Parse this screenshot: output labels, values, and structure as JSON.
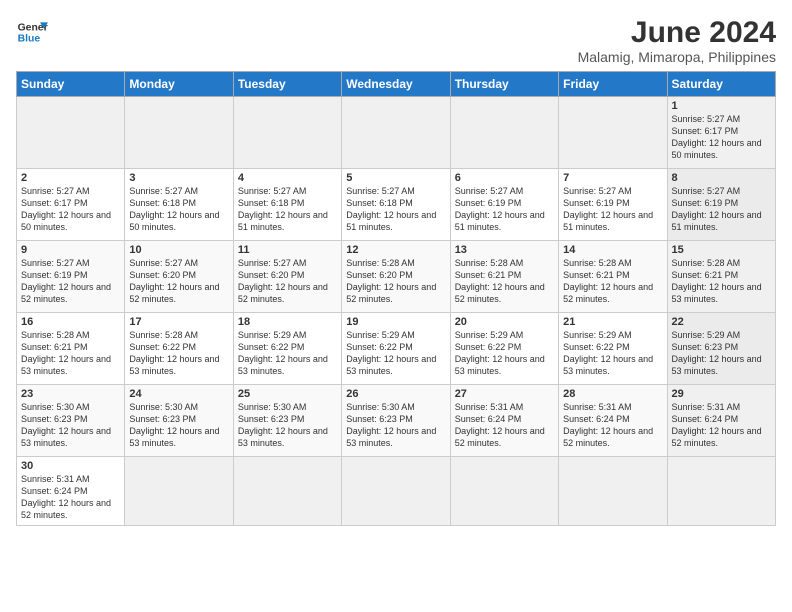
{
  "logo": {
    "line1": "General",
    "line2": "Blue"
  },
  "title": "June 2024",
  "subtitle": "Malamig, Mimaropa, Philippines",
  "days_of_week": [
    "Sunday",
    "Monday",
    "Tuesday",
    "Wednesday",
    "Thursday",
    "Friday",
    "Saturday"
  ],
  "weeks": [
    [
      {
        "day": "",
        "info": ""
      },
      {
        "day": "",
        "info": ""
      },
      {
        "day": "",
        "info": ""
      },
      {
        "day": "",
        "info": ""
      },
      {
        "day": "",
        "info": ""
      },
      {
        "day": "",
        "info": ""
      },
      {
        "day": "1",
        "info": "Sunrise: 5:27 AM\nSunset: 6:17 PM\nDaylight: 12 hours\nand 50 minutes."
      }
    ],
    [
      {
        "day": "2",
        "info": "Sunrise: 5:27 AM\nSunset: 6:17 PM\nDaylight: 12 hours\nand 50 minutes."
      },
      {
        "day": "3",
        "info": "Sunrise: 5:27 AM\nSunset: 6:18 PM\nDaylight: 12 hours\nand 50 minutes."
      },
      {
        "day": "4",
        "info": "Sunrise: 5:27 AM\nSunset: 6:18 PM\nDaylight: 12 hours\nand 51 minutes."
      },
      {
        "day": "5",
        "info": "Sunrise: 5:27 AM\nSunset: 6:18 PM\nDaylight: 12 hours\nand 51 minutes."
      },
      {
        "day": "6",
        "info": "Sunrise: 5:27 AM\nSunset: 6:19 PM\nDaylight: 12 hours\nand 51 minutes."
      },
      {
        "day": "7",
        "info": "Sunrise: 5:27 AM\nSunset: 6:19 PM\nDaylight: 12 hours\nand 51 minutes."
      },
      {
        "day": "8",
        "info": "Sunrise: 5:27 AM\nSunset: 6:19 PM\nDaylight: 12 hours\nand 51 minutes."
      }
    ],
    [
      {
        "day": "9",
        "info": "Sunrise: 5:27 AM\nSunset: 6:19 PM\nDaylight: 12 hours\nand 52 minutes."
      },
      {
        "day": "10",
        "info": "Sunrise: 5:27 AM\nSunset: 6:20 PM\nDaylight: 12 hours\nand 52 minutes."
      },
      {
        "day": "11",
        "info": "Sunrise: 5:27 AM\nSunset: 6:20 PM\nDaylight: 12 hours\nand 52 minutes."
      },
      {
        "day": "12",
        "info": "Sunrise: 5:28 AM\nSunset: 6:20 PM\nDaylight: 12 hours\nand 52 minutes."
      },
      {
        "day": "13",
        "info": "Sunrise: 5:28 AM\nSunset: 6:21 PM\nDaylight: 12 hours\nand 52 minutes."
      },
      {
        "day": "14",
        "info": "Sunrise: 5:28 AM\nSunset: 6:21 PM\nDaylight: 12 hours\nand 52 minutes."
      },
      {
        "day": "15",
        "info": "Sunrise: 5:28 AM\nSunset: 6:21 PM\nDaylight: 12 hours\nand 53 minutes."
      }
    ],
    [
      {
        "day": "16",
        "info": "Sunrise: 5:28 AM\nSunset: 6:21 PM\nDaylight: 12 hours\nand 53 minutes."
      },
      {
        "day": "17",
        "info": "Sunrise: 5:28 AM\nSunset: 6:22 PM\nDaylight: 12 hours\nand 53 minutes."
      },
      {
        "day": "18",
        "info": "Sunrise: 5:29 AM\nSunset: 6:22 PM\nDaylight: 12 hours\nand 53 minutes."
      },
      {
        "day": "19",
        "info": "Sunrise: 5:29 AM\nSunset: 6:22 PM\nDaylight: 12 hours\nand 53 minutes."
      },
      {
        "day": "20",
        "info": "Sunrise: 5:29 AM\nSunset: 6:22 PM\nDaylight: 12 hours\nand 53 minutes."
      },
      {
        "day": "21",
        "info": "Sunrise: 5:29 AM\nSunset: 6:22 PM\nDaylight: 12 hours\nand 53 minutes."
      },
      {
        "day": "22",
        "info": "Sunrise: 5:29 AM\nSunset: 6:23 PM\nDaylight: 12 hours\nand 53 minutes."
      }
    ],
    [
      {
        "day": "23",
        "info": "Sunrise: 5:30 AM\nSunset: 6:23 PM\nDaylight: 12 hours\nand 53 minutes."
      },
      {
        "day": "24",
        "info": "Sunrise: 5:30 AM\nSunset: 6:23 PM\nDaylight: 12 hours\nand 53 minutes."
      },
      {
        "day": "25",
        "info": "Sunrise: 5:30 AM\nSunset: 6:23 PM\nDaylight: 12 hours\nand 53 minutes."
      },
      {
        "day": "26",
        "info": "Sunrise: 5:30 AM\nSunset: 6:23 PM\nDaylight: 12 hours\nand 53 minutes."
      },
      {
        "day": "27",
        "info": "Sunrise: 5:31 AM\nSunset: 6:24 PM\nDaylight: 12 hours\nand 52 minutes."
      },
      {
        "day": "28",
        "info": "Sunrise: 5:31 AM\nSunset: 6:24 PM\nDaylight: 12 hours\nand 52 minutes."
      },
      {
        "day": "29",
        "info": "Sunrise: 5:31 AM\nSunset: 6:24 PM\nDaylight: 12 hours\nand 52 minutes."
      }
    ],
    [
      {
        "day": "30",
        "info": "Sunrise: 5:31 AM\nSunset: 6:24 PM\nDaylight: 12 hours\nand 52 minutes."
      },
      {
        "day": "",
        "info": ""
      },
      {
        "day": "",
        "info": ""
      },
      {
        "day": "",
        "info": ""
      },
      {
        "day": "",
        "info": ""
      },
      {
        "day": "",
        "info": ""
      },
      {
        "day": "",
        "info": ""
      }
    ]
  ]
}
